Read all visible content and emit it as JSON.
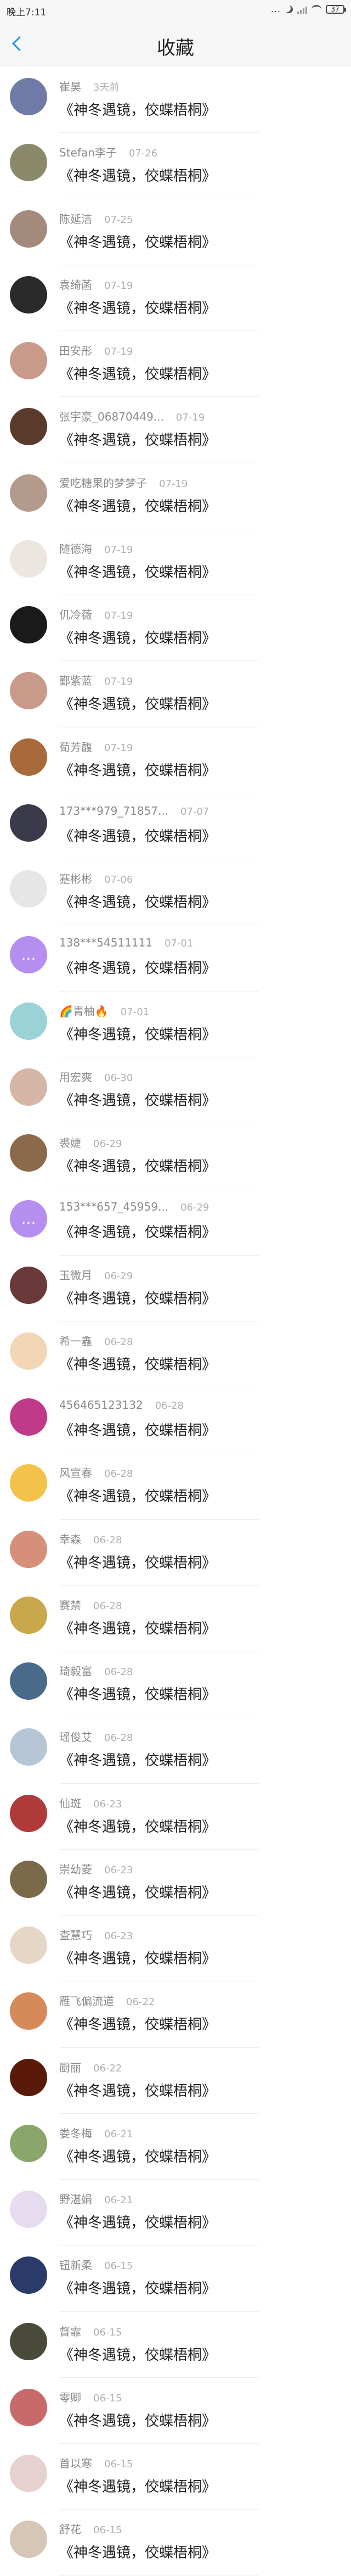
{
  "status_bar": {
    "time": "晚上7:11",
    "dots": "...",
    "battery": "37"
  },
  "header": {
    "title": "收藏"
  },
  "items": [
    {
      "name": "崔昊",
      "date": "3天前",
      "title": "《神冬遇镜，佼蝶梧桐》",
      "color": "#6f7aa6",
      "glyph": ""
    },
    {
      "name": "Stefan李子",
      "date": "07-26",
      "title": "《神冬遇镜，佼蝶梧桐》",
      "color": "#8a8a6a",
      "glyph": ""
    },
    {
      "name": "陈延洁",
      "date": "07-25",
      "title": "《神冬遇镜，佼蝶梧桐》",
      "color": "#a38a7a",
      "glyph": ""
    },
    {
      "name": "袁绮菡",
      "date": "07-19",
      "title": "《神冬遇镜，佼蝶梧桐》",
      "color": "#2a2a2a",
      "glyph": ""
    },
    {
      "name": "田安彤",
      "date": "07-19",
      "title": "《神冬遇镜，佼蝶梧桐》",
      "color": "#c89a8a",
      "glyph": ""
    },
    {
      "name": "张宇豪_06870449...",
      "date": "07-19",
      "title": "《神冬遇镜，佼蝶梧桐》",
      "color": "#5a3a2a",
      "glyph": ""
    },
    {
      "name": "爱吃糖果的梦梦子",
      "date": "07-19",
      "title": "《神冬遇镜，佼蝶梧桐》",
      "color": "#b49a8a",
      "glyph": ""
    },
    {
      "name": "随德海",
      "date": "07-19",
      "title": "《神冬遇镜，佼蝶梧桐》",
      "color": "#ece6e0",
      "glyph": ""
    },
    {
      "name": "仉冷薇",
      "date": "07-19",
      "title": "《神冬遇镜，佼蝶梧桐》",
      "color": "#1a1a1a",
      "glyph": ""
    },
    {
      "name": "鄞紫蓝",
      "date": "07-19",
      "title": "《神冬遇镜，佼蝶梧桐》",
      "color": "#c89a8a",
      "glyph": ""
    },
    {
      "name": "荀芳馥",
      "date": "07-19",
      "title": "《神冬遇镜，佼蝶梧桐》",
      "color": "#a86a3a",
      "glyph": ""
    },
    {
      "name": "173***979_71857...",
      "date": "07-07",
      "title": "《神冬遇镜，佼蝶梧桐》",
      "color": "#3a3a4a",
      "glyph": ""
    },
    {
      "name": "蹇彬彬",
      "date": "07-06",
      "title": "《神冬遇镜，佼蝶梧桐》",
      "color": "#e6e6e6",
      "glyph": ""
    },
    {
      "name": "138***54511111",
      "date": "07-01",
      "title": "《神冬遇镜，佼蝶梧桐》",
      "color": "#b58ef0",
      "glyph": "..."
    },
    {
      "name": "🌈青柚🔥",
      "date": "07-01",
      "title": "《神冬遇镜，佼蝶梧桐》",
      "color": "#9ad2d8",
      "glyph": ""
    },
    {
      "name": "用宏爽",
      "date": "06-30",
      "title": "《神冬遇镜，佼蝶梧桐》",
      "color": "#d6b6a6",
      "glyph": ""
    },
    {
      "name": "裘婕",
      "date": "06-29",
      "title": "《神冬遇镜，佼蝶梧桐》",
      "color": "#8a6a4a",
      "glyph": ""
    },
    {
      "name": "153***657_45959...",
      "date": "06-29",
      "title": "《神冬遇镜，佼蝶梧桐》",
      "color": "#b58ef0",
      "glyph": "..."
    },
    {
      "name": "玉微月",
      "date": "06-29",
      "title": "《神冬遇镜，佼蝶梧桐》",
      "color": "#6a3a3a",
      "glyph": ""
    },
    {
      "name": "希一鑫",
      "date": "06-28",
      "title": "《神冬遇镜，佼蝶梧桐》",
      "color": "#f2d6b6",
      "glyph": ""
    },
    {
      "name": "456465123132",
      "date": "06-28",
      "title": "《神冬遇镜，佼蝶梧桐》",
      "color": "#c03a8a",
      "glyph": ""
    },
    {
      "name": "风宣春",
      "date": "06-28",
      "title": "《神冬遇镜，佼蝶梧桐》",
      "color": "#f2c24a",
      "glyph": ""
    },
    {
      "name": "幸森",
      "date": "06-28",
      "title": "《神冬遇镜，佼蝶梧桐》",
      "color": "#d6907a",
      "glyph": ""
    },
    {
      "name": "赛禁",
      "date": "06-28",
      "title": "《神冬遇镜，佼蝶梧桐》",
      "color": "#c8a84a",
      "glyph": ""
    },
    {
      "name": "琦毅富",
      "date": "06-28",
      "title": "《神冬遇镜，佼蝶梧桐》",
      "color": "#4a6a8a",
      "glyph": ""
    },
    {
      "name": "瑶俊艾",
      "date": "06-28",
      "title": "《神冬遇镜，佼蝶梧桐》",
      "color": "#b6c6d6",
      "glyph": ""
    },
    {
      "name": "仙斑",
      "date": "06-23",
      "title": "《神冬遇镜，佼蝶梧桐》",
      "color": "#b03a3a",
      "glyph": ""
    },
    {
      "name": "崇幼菱",
      "date": "06-23",
      "title": "《神冬遇镜，佼蝶梧桐》",
      "color": "#7a6a4a",
      "glyph": ""
    },
    {
      "name": "查慧巧",
      "date": "06-23",
      "title": "《神冬遇镜，佼蝶梧桐》",
      "color": "#e6d6c6",
      "glyph": ""
    },
    {
      "name": "雁飞偏流道",
      "date": "06-22",
      "title": "《神冬遇镜，佼蝶梧桐》",
      "color": "#d68a5a",
      "glyph": ""
    },
    {
      "name": "厨丽",
      "date": "06-22",
      "title": "《神冬遇镜，佼蝶梧桐》",
      "color": "#5a1a0a",
      "glyph": ""
    },
    {
      "name": "娄冬梅",
      "date": "06-21",
      "title": "《神冬遇镜，佼蝶梧桐》",
      "color": "#8aa66a",
      "glyph": ""
    },
    {
      "name": "野湛娟",
      "date": "06-21",
      "title": "《神冬遇镜，佼蝶梧桐》",
      "color": "#e6dcf0",
      "glyph": ""
    },
    {
      "name": "钮新柔",
      "date": "06-15",
      "title": "《神冬遇镜，佼蝶梧桐》",
      "color": "#2a3a6a",
      "glyph": ""
    },
    {
      "name": "督霏",
      "date": "06-15",
      "title": "《神冬遇镜，佼蝶梧桐》",
      "color": "#4a4a3a",
      "glyph": ""
    },
    {
      "name": "零卿",
      "date": "06-15",
      "title": "《神冬遇镜，佼蝶梧桐》",
      "color": "#c86a6a",
      "glyph": ""
    },
    {
      "name": "首以寒",
      "date": "06-15",
      "title": "《神冬遇镜，佼蝶梧桐》",
      "color": "#e6d0d0",
      "glyph": ""
    },
    {
      "name": "舒花",
      "date": "06-15",
      "title": "《神冬遇镜，佼蝶梧桐》",
      "color": "#d6c6b6",
      "glyph": ""
    }
  ]
}
